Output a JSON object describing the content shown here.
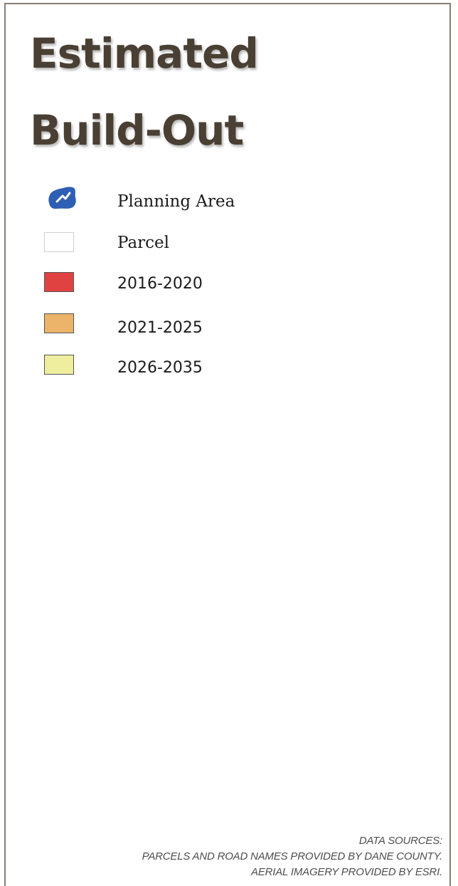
{
  "title": {
    "line1": "Estimated",
    "line2": "Build-Out"
  },
  "legend": {
    "items": [
      {
        "label": "Planning Area",
        "type": "area-icon",
        "color": "#2e5fb5",
        "icon": "planning-area-icon"
      },
      {
        "label": "Parcel",
        "type": "swatch",
        "color": "#ffffff"
      },
      {
        "label": "2016-2020",
        "type": "swatch",
        "color": "#e04141"
      },
      {
        "label": "2021-2025",
        "type": "swatch",
        "color": "#ebb46a"
      },
      {
        "label": "2026-2035",
        "type": "swatch",
        "color": "#eeee9e"
      }
    ]
  },
  "sources": {
    "heading": "DATA SOURCES:",
    "line1": "PARCELS AND ROAD NAMES PROVIDED BY DANE COUNTY.",
    "line2": "AERIAL IMAGERY PROVIDED BY ESRI."
  },
  "colors": {
    "border": "#8a7e72",
    "title": "#4a3f33"
  }
}
